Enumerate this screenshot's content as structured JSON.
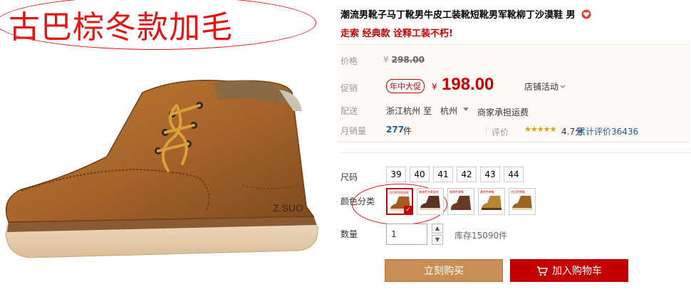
{
  "gallery": {
    "promo_text": "古巴棕冬款加毛",
    "shoe_brand": "Z.SUO"
  },
  "product": {
    "title": "潮流男靴子马丁靴男牛皮工装靴短靴男军靴柳丁沙漠鞋 男",
    "subtitle": "走索 经典款 诠释工装不朽!",
    "title_icon": "heart-badge-icon"
  },
  "pricing": {
    "original_label": "价格",
    "original_currency": "¥",
    "original_price": "298.00",
    "promo_label": "促销",
    "promo_badge": "年中大促",
    "promo_currency": "¥",
    "promo_price": "198.00",
    "store_activity": "店铺活动"
  },
  "shipping": {
    "label": "配送",
    "from": "浙江杭州",
    "to_word": "至",
    "to_city": "杭州",
    "fee": "商家承担运费"
  },
  "sales": {
    "label": "月销量",
    "count": "277",
    "unit": "件",
    "eval_label": "评价",
    "stars": "★★★★★",
    "rating": 4.7,
    "score_text": "4.7分",
    "eval_count": "累计评价36436"
  },
  "sku": {
    "size_label": "尺码",
    "sizes": [
      "39",
      "40",
      "41",
      "42",
      "43",
      "44"
    ],
    "color_label": "颜色分类",
    "colors": [
      {
        "tag": "古巴棕冬款加毛",
        "color": "#a65a1e",
        "selected": true
      },
      {
        "tag": "咖啡色冬款加毛",
        "color": "#5a3220",
        "selected": false
      },
      {
        "tag": "咖啡色单鞋",
        "color": "#6a3a22",
        "selected": false
      },
      {
        "tag": "黄棕色单鞋",
        "color": "#b8862e",
        "selected": false
      },
      {
        "tag": "古巴棕单鞋",
        "color": "#9a6426",
        "selected": false
      }
    ],
    "qty_label": "数量",
    "qty_value": "1",
    "stock_text": "库存15090件"
  },
  "actions": {
    "buy_now": "立刻购买",
    "add_cart": "加入购物车"
  },
  "colors": {
    "accent_red": "#c40000",
    "promo_red": "#e31414",
    "buy_button": "#c88e55",
    "link_blue": "#1f5c99"
  }
}
